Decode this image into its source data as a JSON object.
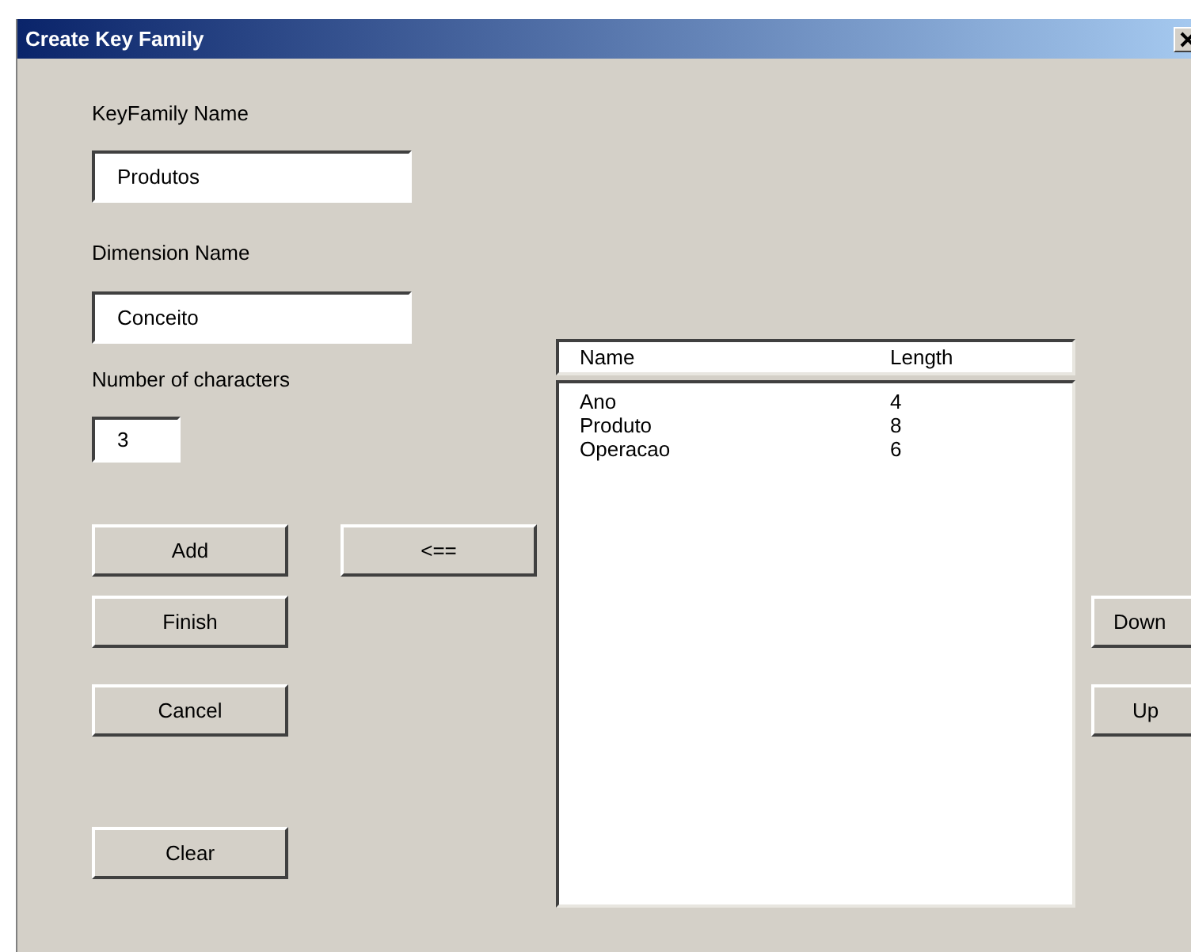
{
  "window": {
    "title": "Create Key Family"
  },
  "fields": [
    {
      "label": "KeyFamily Name",
      "value": "Produtos"
    },
    {
      "label": "Dimension Name",
      "value": "Conceito"
    },
    {
      "label": "Number of characters",
      "value": "3"
    }
  ],
  "action_buttons": [
    "Add",
    "Finish",
    "Cancel",
    "Clear"
  ],
  "move_button": "<==",
  "list": {
    "columns": [
      "Name",
      "Length"
    ],
    "rows": [
      [
        "Ano",
        "4"
      ],
      [
        "Produto",
        "8"
      ],
      [
        "Operacao",
        "6"
      ]
    ]
  },
  "order_buttons": [
    "Down",
    "Up"
  ]
}
